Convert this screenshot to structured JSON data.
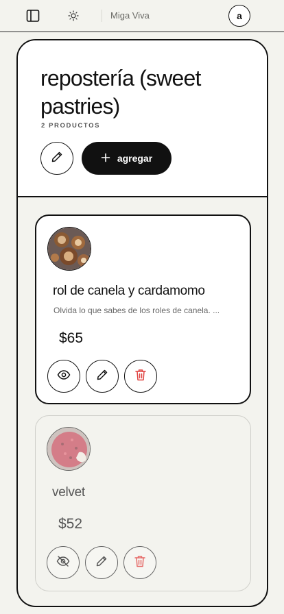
{
  "topbar": {
    "brand": "Miga Viva",
    "avatar_letter": "a",
    "icons": [
      "sidebar-toggle-icon",
      "sun-icon"
    ]
  },
  "category": {
    "title": "repostería (sweet pastries)",
    "count": "2 PRODUCTOS",
    "add_label": "agregar"
  },
  "products": [
    {
      "name": "rol de canela y cardamomo",
      "description": "Olvida lo que sabes de los roles de canela. ...",
      "price": "$65",
      "visible": true
    },
    {
      "name": "velvet",
      "description": "",
      "price": "$52",
      "visible": false
    }
  ],
  "colors": {
    "background": "#f3f3ee",
    "ink": "#111111",
    "danger": "#e0413f"
  }
}
